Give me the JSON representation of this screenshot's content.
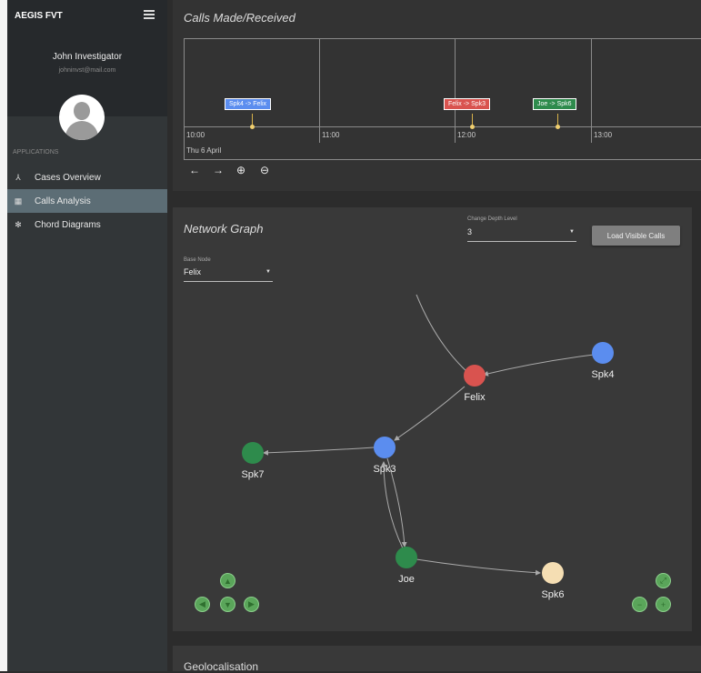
{
  "app": {
    "brand": "AEGIS FVT"
  },
  "user": {
    "name": "John Investigator",
    "email": "johninvst@mail.com"
  },
  "sidebar": {
    "section_label": "APPLICATIONS",
    "items": [
      {
        "label": "Cases Overview",
        "icon": "sitemap-icon",
        "active": false
      },
      {
        "label": "Calls Analysis",
        "icon": "table-icon",
        "active": true
      },
      {
        "label": "Chord Diagrams",
        "icon": "cog-icon",
        "active": false
      }
    ]
  },
  "timeline": {
    "title": "Calls Made/Received",
    "ticks": [
      "10:00",
      "11:00",
      "12:00",
      "13:00"
    ],
    "date": "Thu 6 April",
    "events": [
      {
        "label": "Spk4 -> Felix",
        "color": "#5b8def"
      },
      {
        "label": "Felix -> Spk3",
        "color": "#d9534f"
      },
      {
        "label": "Joe -> Spk6",
        "color": "#2e8b4c"
      }
    ],
    "controls": [
      "←",
      "→",
      "⊕",
      "⊖"
    ]
  },
  "network": {
    "title": "Network Graph",
    "depth_label": "Change Depth Level",
    "depth_value": "3",
    "base_label": "Base Node",
    "base_value": "Felix",
    "load_button": "Load Visible Calls",
    "nodes": [
      {
        "id": "Felix",
        "label": "Felix",
        "color": "#d9534f"
      },
      {
        "id": "Spk4",
        "label": "Spk4",
        "color": "#5b8def"
      },
      {
        "id": "Spk3",
        "label": "Spk3",
        "color": "#5b8def"
      },
      {
        "id": "Spk7",
        "label": "Spk7",
        "color": "#2e8b4c"
      },
      {
        "id": "Joe",
        "label": "Joe",
        "color": "#2e8b4c"
      },
      {
        "id": "Spk6",
        "label": "Spk6",
        "color": "#f5deb3"
      }
    ],
    "edges": [
      {
        "from": "Spk4",
        "to": "Felix"
      },
      {
        "from": "Felix",
        "to": "Spk3"
      },
      {
        "from": "Spk3",
        "to": "Spk7"
      },
      {
        "from": "Spk3",
        "to": "Joe"
      },
      {
        "from": "Joe",
        "to": "Spk3"
      },
      {
        "from": "Joe",
        "to": "Spk6"
      }
    ],
    "nav_icons": [
      "arrow-up-icon",
      "arrow-left-icon",
      "arrow-down-icon",
      "arrow-right-icon"
    ],
    "zoom_icons": [
      "zoom-fit-icon",
      "zoom-out-icon",
      "zoom-in-icon"
    ]
  },
  "geo": {
    "title": "Geolocalisation"
  }
}
